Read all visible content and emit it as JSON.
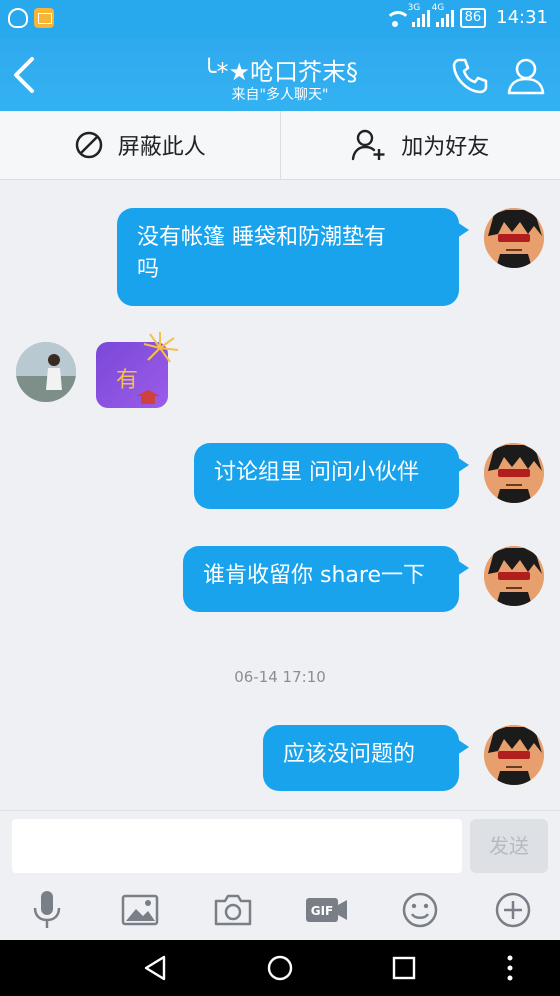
{
  "status_bar": {
    "network_left": "3G",
    "network_right": "4G",
    "battery": "86",
    "time": "14:31"
  },
  "header": {
    "title": "╰*★呛口芥末§",
    "subtitle": "来自\"多人聊天\""
  },
  "actions": {
    "block_label": "屏蔽此人",
    "add_friend_label": "加为好友"
  },
  "messages": [
    {
      "sender": "me",
      "lines": [
        "没有帐篷  睡袋和防潮垫有",
        "吗"
      ]
    },
    {
      "sender": "other",
      "sticker_text": "有"
    },
    {
      "sender": "me",
      "lines": [
        "讨论组里 问问小伙伴"
      ]
    },
    {
      "sender": "me",
      "lines": [
        "谁肯收留你 share一下"
      ]
    },
    {
      "sender": "me",
      "lines": [
        "应该没问题的"
      ]
    }
  ],
  "timestamp": "06-14 17:10",
  "input": {
    "placeholder": "",
    "send_label": "发送"
  },
  "toolbar_icons": [
    "microphone-icon",
    "image-icon",
    "camera-icon",
    "gif-icon",
    "emoji-icon",
    "plus-icon"
  ],
  "nav_icons": [
    "back-triangle-icon",
    "home-circle-icon",
    "recents-square-icon"
  ],
  "colors": {
    "accent": "#28a9ee",
    "bubble": "#1aa3ed",
    "background": "#eef0f4"
  }
}
